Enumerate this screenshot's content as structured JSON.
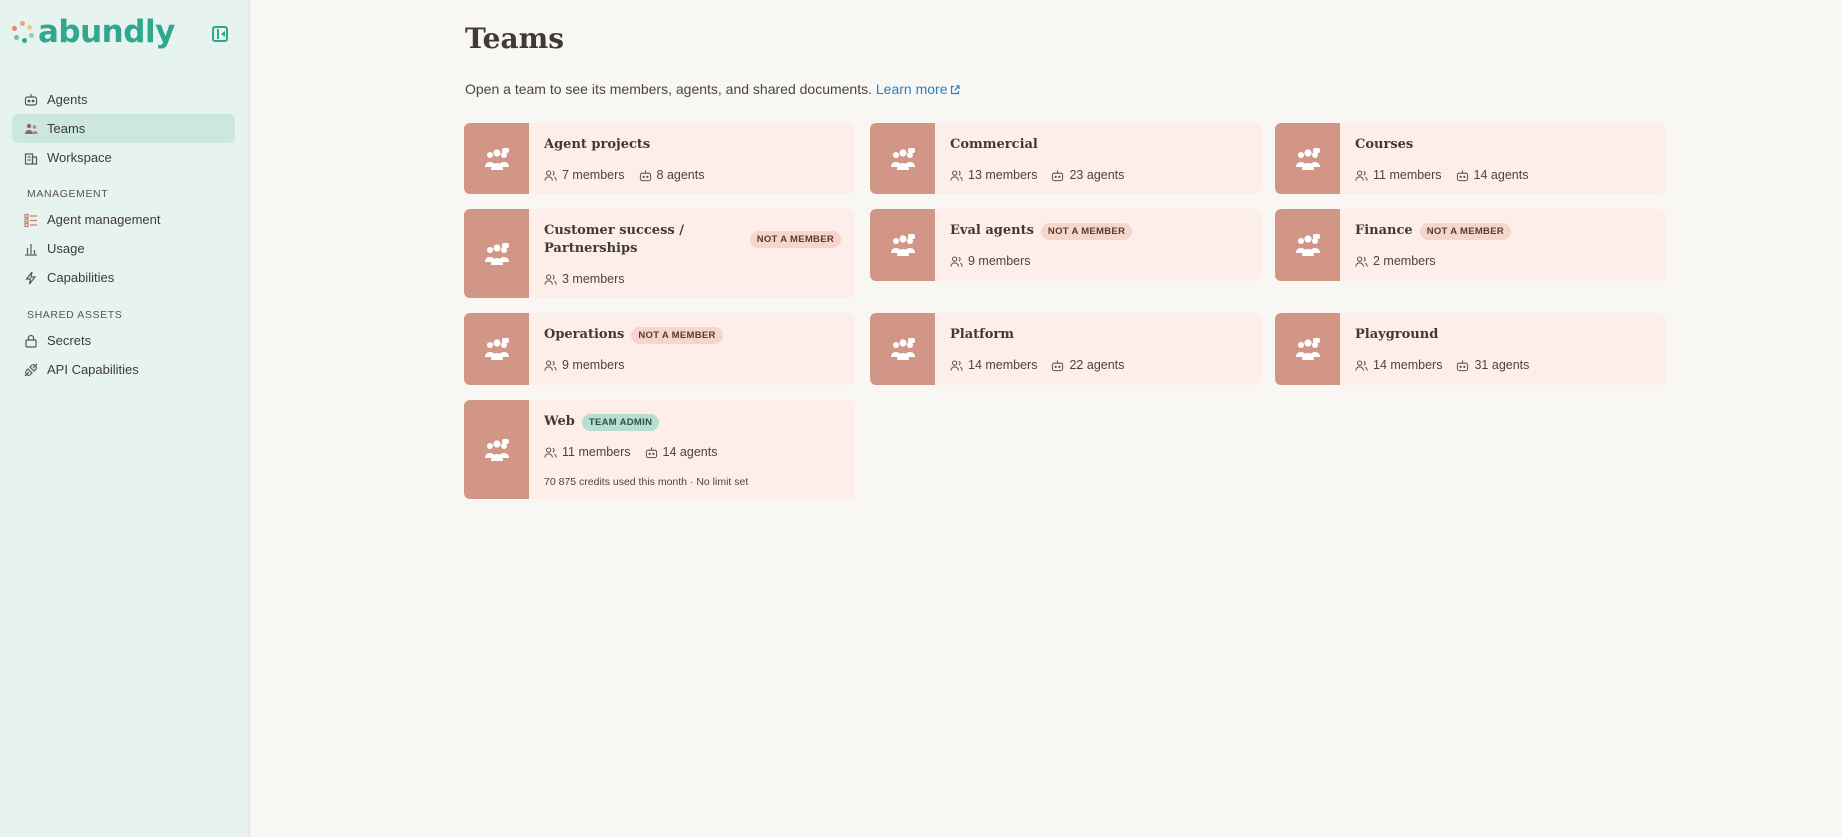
{
  "app": {
    "name": "abundly"
  },
  "sidebar": {
    "nav": [
      {
        "label": "Agents",
        "icon": "robot-icon"
      },
      {
        "label": "Teams",
        "icon": "team-icon",
        "active": true
      },
      {
        "label": "Workspace",
        "icon": "building-icon"
      }
    ],
    "management_label": "MANAGEMENT",
    "management": [
      {
        "label": "Agent management",
        "icon": "list-icon"
      },
      {
        "label": "Usage",
        "icon": "bar-chart-icon"
      },
      {
        "label": "Capabilities",
        "icon": "lightning-icon"
      }
    ],
    "shared_label": "SHARED ASSETS",
    "shared": [
      {
        "label": "Secrets",
        "icon": "lock-icon"
      },
      {
        "label": "API Capabilities",
        "icon": "plug-icon"
      }
    ]
  },
  "main": {
    "title": "Teams",
    "subtitle": "Open a team to see its members, agents, and shared documents.",
    "learn_more": "Learn more"
  },
  "teams": [
    {
      "name": "Agent projects",
      "members": "7 members",
      "agents": "8 agents"
    },
    {
      "name": "Commercial",
      "members": "13 members",
      "agents": "23 agents"
    },
    {
      "name": "Courses",
      "members": "11 members",
      "agents": "14 agents"
    },
    {
      "name": "Customer success / Partnerships",
      "badge": "NOT A MEMBER",
      "members": "3 members"
    },
    {
      "name": "Eval agents",
      "badge": "NOT A MEMBER",
      "members": "9 members"
    },
    {
      "name": "Finance",
      "badge": "NOT A MEMBER",
      "members": "2 members"
    },
    {
      "name": "Operations",
      "badge": "NOT A MEMBER",
      "members": "9 members"
    },
    {
      "name": "Platform",
      "members": "14 members",
      "agents": "22 agents"
    },
    {
      "name": "Playground",
      "members": "14 members",
      "agents": "31 agents"
    },
    {
      "name": "Web",
      "badge": "TEAM ADMIN",
      "members": "11 members",
      "agents": "14 agents",
      "credits": "70 875 credits used this month · No limit set"
    }
  ],
  "colors": {
    "brand": "#2fa88e",
    "sidebar_bg": "#e6f3ef",
    "card_bg": "#fdeee9",
    "card_thumb": "#d29686",
    "link": "#2e7fbf"
  }
}
